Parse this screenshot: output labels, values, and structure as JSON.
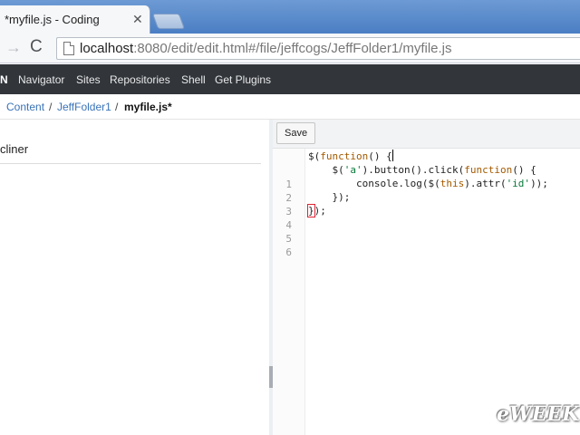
{
  "browser": {
    "tab_title": "*myfile.js - Coding",
    "close_glyph": "✕",
    "url_host": "localhost",
    "url_rest": ":8080/edit/edit.html#/file/jeffcogs/JeffFolder1/myfile.js"
  },
  "appbar": {
    "brand": "N",
    "nav": [
      "Navigator",
      "Sites",
      "Repositories",
      "Shell",
      "Get Plugins"
    ]
  },
  "breadcrumb": {
    "root": "Content",
    "sep": "/",
    "folder": "JeffFolder1",
    "file": "myfile.js*"
  },
  "left_panel": {
    "text": "cliner"
  },
  "editor": {
    "save_label": "Save",
    "line_numbers": [
      "1",
      "2",
      "3",
      "4",
      "5",
      "6"
    ],
    "lines": [
      "$(function() {",
      "    $('a').button().click(function() {",
      "        console.log($(this).attr('id'));",
      "    });",
      "});",
      ""
    ]
  },
  "watermark": "eWEEK",
  "colors": {
    "tabstrip": "#4a7ec3",
    "appbar": "#32363b",
    "link": "#3a73b8",
    "keyword": "#a35a00",
    "string": "#0a7a3b"
  }
}
